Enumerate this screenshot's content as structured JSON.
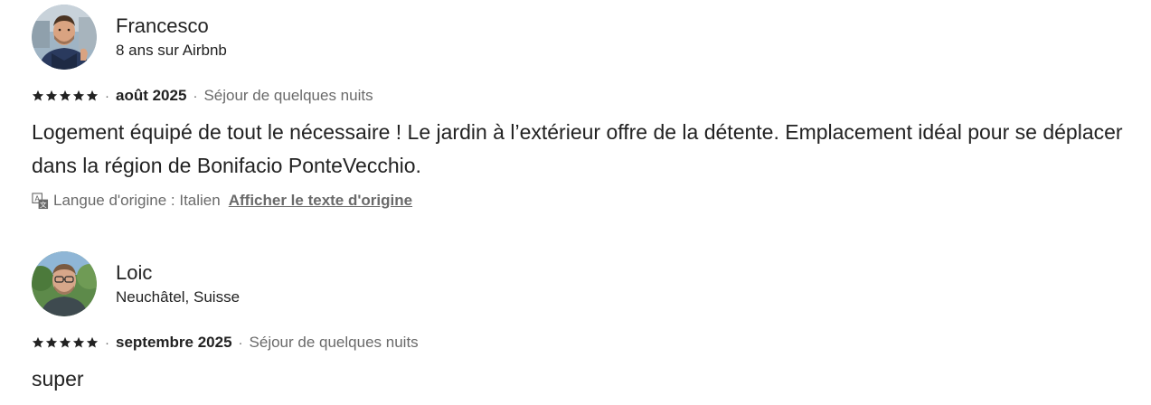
{
  "reviews": [
    {
      "name": "Francesco",
      "meta": "8 ans sur Airbnb",
      "rating": 5,
      "separator": "·",
      "date": "août 2025",
      "stay": "Séjour de quelques nuits",
      "text": "Logement équipé de tout le nécessaire ! Le jardin à l’extérieur offre de la détente. Emplacement idéal pour se déplacer dans la région de Bonifacio PonteVecchio.",
      "translation": {
        "language_label": "Langue d'origine : Italien",
        "show_original_label": "Afficher le texte d'origine"
      }
    },
    {
      "name": "Loic",
      "meta": "Neuchâtel, Suisse",
      "rating": 5,
      "separator": "·",
      "date": "septembre 2025",
      "stay": "Séjour de quelques nuits",
      "text": "super"
    }
  ],
  "colors": {
    "primary_text": "#222222",
    "secondary_text": "#6a6a6a",
    "background": "#ffffff"
  },
  "icons": {
    "star": "star-icon",
    "translate": "translate-icon"
  }
}
